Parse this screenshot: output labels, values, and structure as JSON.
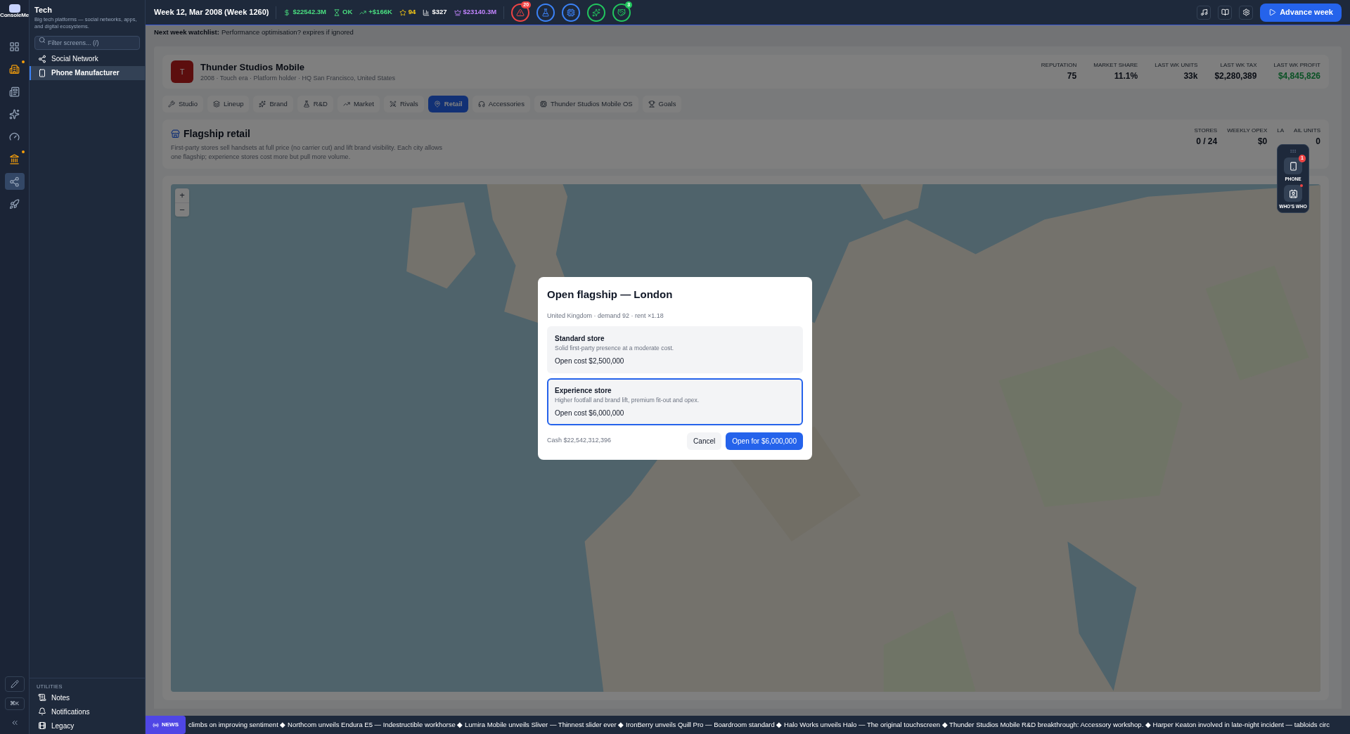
{
  "sidebar": {
    "logo_text": "ConsoleMe",
    "rail": [
      {
        "selected": false,
        "alert": false
      },
      {
        "selected": false,
        "alert": true
      },
      {
        "selected": false,
        "alert": false
      },
      {
        "selected": false,
        "alert": false
      },
      {
        "selected": false,
        "alert": false
      },
      {
        "selected": false,
        "alert": true
      },
      {
        "selected": true,
        "alert": false
      },
      {
        "selected": false,
        "alert": false
      }
    ],
    "rail_shortcut": "⌘K",
    "title": "Tech",
    "description": "Big tech platforms — social networks, apps, and digital ecosystems.",
    "search": {
      "placeholder": "Filter screens... (/)"
    },
    "items": [
      {
        "label": "Social Network",
        "selected": false
      },
      {
        "label": "Phone Manufacturer",
        "selected": true
      }
    ],
    "utilities": {
      "title": "UTILITIES",
      "items": [
        "Notes",
        "Notifications",
        "Legacy"
      ]
    }
  },
  "topbar": {
    "week": "Week 12, Mar 2008 (Week 1260)",
    "stats": [
      {
        "value": "$22542.3M",
        "color": "#4ade80"
      },
      {
        "value": "OK",
        "color": "#4ade80"
      },
      {
        "value": "+$166K",
        "color": "#4ade80"
      },
      {
        "value": "94",
        "color": "#facc15"
      },
      {
        "value": "$327",
        "color": "#ffffff"
      },
      {
        "value": "$23140.3M",
        "color": "#c084fc"
      }
    ],
    "alerts": [
      {
        "color": "#ef4444",
        "badge": "20"
      },
      {
        "color": "#3b82f6"
      },
      {
        "color": "#3b82f6"
      },
      {
        "color": "#22c55e"
      },
      {
        "color": "#22c55e",
        "badge": "3"
      }
    ],
    "advance_button": "Advance week"
  },
  "watchlist": {
    "label": "Next week watchlist:",
    "text": "Performance optimisation? expires if ignored"
  },
  "studio": {
    "logo_letter": "T",
    "name": "Thunder Studios Mobile",
    "subtitle": "2008 · Touch era · Platform holder · HQ San Francisco, United States",
    "stats": [
      {
        "label": "REPUTATION",
        "value": "75",
        "positive": false
      },
      {
        "label": "MARKET SHARE",
        "value": "11.1%",
        "positive": false
      },
      {
        "label": "LAST WK UNITS",
        "value": "33k",
        "positive": false
      },
      {
        "label": "LAST WK TAX",
        "value": "$2,280,389",
        "positive": false
      },
      {
        "label": "LAST WK PROFIT",
        "value": "$4,845,826",
        "positive": true
      }
    ]
  },
  "tabs": [
    {
      "label": "Studio",
      "selected": false
    },
    {
      "label": "Lineup",
      "selected": false
    },
    {
      "label": "Brand",
      "selected": false
    },
    {
      "label": "R&D",
      "selected": false
    },
    {
      "label": "Market",
      "selected": false
    },
    {
      "label": "Rivals",
      "selected": false
    },
    {
      "label": "Retail",
      "selected": true
    },
    {
      "label": "Accessories",
      "selected": false
    },
    {
      "label": "Thunder Studios Mobile OS",
      "selected": false
    },
    {
      "label": "Goals",
      "selected": false
    }
  ],
  "retail": {
    "title": "Flagship retail",
    "description": "First-party stores sell handsets at full price (no carrier cut) and lift brand visibility. Each city allows one flagship; experience stores cost more but pull more volume.",
    "stats": [
      {
        "label": "STORES",
        "value": "0 / 24"
      },
      {
        "label": "WEEKLY OPEX",
        "value": "$0"
      },
      {
        "label": "LA"
      },
      {
        "label": "AIL UNITS",
        "value": "0"
      }
    ]
  },
  "map": {
    "zoom_in": "+",
    "zoom_out": "−"
  },
  "dock": [
    {
      "label": "PHONE",
      "badge": "1",
      "dot": false
    },
    {
      "label": "WHO'S WHO",
      "dot": true
    }
  ],
  "dialog": {
    "title": "Open flagship — London",
    "subtitle": "United Kingdom · demand 92 · rent ×1.18",
    "options": [
      {
        "title": "Standard store",
        "description": "Solid first-party presence at a moderate cost.",
        "cost": "Open cost $2,500,000",
        "selected": false
      },
      {
        "title": "Experience store",
        "description": "Higher footfall and brand lift, premium fit-out and opex.",
        "cost": "Open cost $6,000,000",
        "selected": true
      }
    ],
    "cash": "Cash $22,542,312,396",
    "cancel": "Cancel",
    "confirm": "Open for $6,000,000"
  },
  "news": {
    "badge": "NEWS",
    "text": "climbs on improving sentiment ◆ Northcom unveils Endura E5 — Indestructible workhorse ◆ Lumira Mobile unveils Sliver — Thinnest slider ever ◆ IronBerry unveils Quill Pro — Boardroom standard ◆ Halo Works unveils Halo — The original touchscreen ◆ Thunder Studios Mobile R&D breakthrough: Accessory workshop. ◆ Harper Keaton involved in late-night incident — tabloids circ"
  }
}
